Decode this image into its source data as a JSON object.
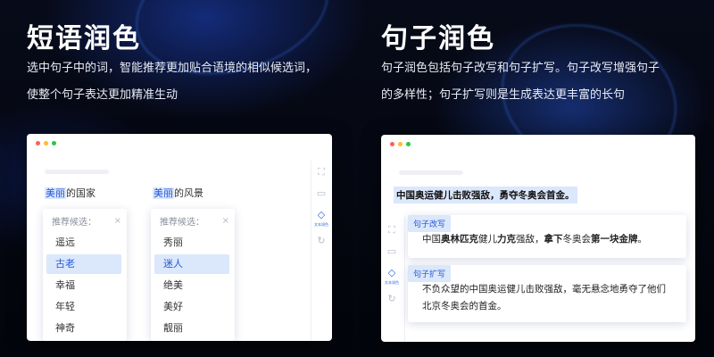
{
  "left": {
    "title": "短语润色",
    "desc_line1": "选中句子中的词，智能推荐更加贴合语境的相似候选词，",
    "desc_line2": "使整个句子表达更加精准生动",
    "phrases": [
      {
        "highlight": "美丽",
        "rest": "的国家",
        "cands_title": "推荐候选：",
        "close": "×",
        "options": [
          "遥远",
          "古老",
          "幸福",
          "年轻",
          "神奇"
        ],
        "selected_index": 1
      },
      {
        "highlight": "美丽",
        "rest": "的风景",
        "cands_title": "推荐候选：",
        "close": "×",
        "options": [
          "秀丽",
          "迷人",
          "绝美",
          "美好",
          "靓丽"
        ],
        "selected_index": 1
      }
    ],
    "sidebar_active_caption": "文本润色"
  },
  "right": {
    "title": "句子润色",
    "desc_line1": "句子润色包括句子改写和句子扩写。句子改写增强句子",
    "desc_line2": "的多样性；句子扩写则是生成表达更丰富的长句",
    "original": "中国奥运健儿击败强敌，勇夺冬奥会首金。",
    "rewrite": {
      "tag": "句子改写",
      "pre": "中国",
      "b1": "奥林匹克",
      "mid1": "健儿",
      "b2": "力克",
      "mid2": "强敌，",
      "b3": "拿下",
      "mid3": "冬奥会",
      "b4": "第一块金牌",
      "end": "。"
    },
    "expand": {
      "tag": "句子扩写",
      "line1": "不负众望的中国奥运健儿击败强敌，毫无悬念地勇夺了他们",
      "line2": "北京冬奥会的首金。"
    },
    "sidebar_active_caption": "文本润色"
  },
  "icons": {
    "scan": "scan-icon",
    "chat": "chat-icon",
    "polish": "polish-icon",
    "refresh": "refresh-icon"
  },
  "colors": {
    "accent": "#2457d6",
    "highlight_bg": "#dbe7fb"
  }
}
